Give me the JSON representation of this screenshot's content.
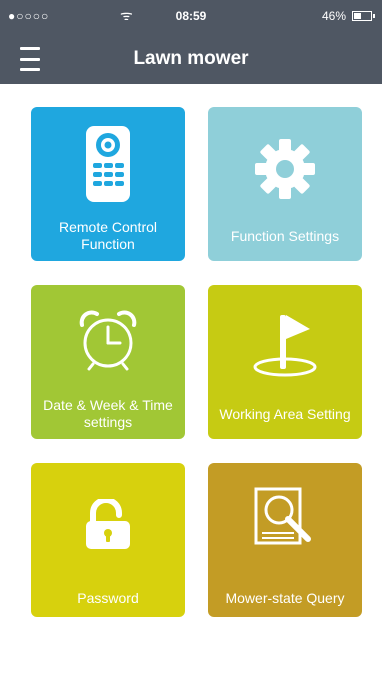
{
  "status_bar": {
    "signal": "●○○○○",
    "wifi": "ᯤ",
    "time": "08:59",
    "battery": "46%"
  },
  "nav": {
    "title": "Lawn mower"
  },
  "tiles": [
    {
      "label": "Remote Control Function",
      "icon": "remote-control-icon",
      "color": "#1fa7df"
    },
    {
      "label": "Function Settings",
      "icon": "gear-icon",
      "color": "#8fcfd9"
    },
    {
      "label": "Date & Week & Time settings",
      "icon": "alarm-clock-icon",
      "color": "#a1c735"
    },
    {
      "label": "Working Area Setting",
      "icon": "flag-icon",
      "color": "#c6cb13"
    },
    {
      "label": "Password",
      "icon": "padlock-icon",
      "color": "#d7d10d"
    },
    {
      "label": "Mower-state Query",
      "icon": "document-search-icon",
      "color": "#c39c25"
    }
  ]
}
